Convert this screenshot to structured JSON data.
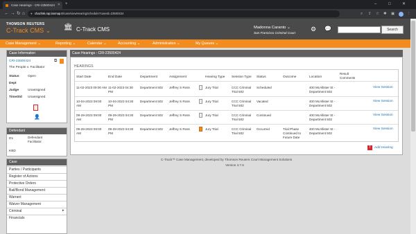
{
  "browser": {
    "tab_title": "Case Hearings - CRI-23500424",
    "url_host": "chazlink.rap.lanmap.tr",
    "url_path": "/case/viewHearingSchedule?caseId=23500424",
    "new_tab": "+",
    "win_minimize": "–",
    "win_maximize": "□",
    "win_close": "✕"
  },
  "header": {
    "company": "THOMSON REUTERS",
    "product": "C-Track CMS ⌄",
    "title": "C-Track CMS",
    "user_name": "Madonna Caranto ⌄",
    "court": "San Francisco Criminal Court",
    "search_placeholder": "",
    "search_button": "Search"
  },
  "nav": {
    "items": [
      "Case Management ⌄",
      "Reporting ⌄",
      "Calendar ⌄",
      "Accounting ⌄",
      "Administration ⌄",
      "My Queues ⌄"
    ]
  },
  "case_info": {
    "header": "Case Information",
    "case_number": "CRI-23500424",
    "case_title": "The People v. Facilitator",
    "status_label": "Status",
    "status_value": "Open",
    "dept_label": "Dept",
    "judge_label": "Judge",
    "judge_value": "Unassigned",
    "timeline_label": "TimeStd",
    "timeline_value": "Unassigned"
  },
  "defendant": {
    "header": "Defendant",
    "num": "D1",
    "name": "Defendant Facilitator",
    "kbd": "KBD"
  },
  "case_menu": {
    "header": "Case",
    "items": [
      "Parties / Participants",
      "Register of Actions",
      "Protective Orders",
      "Bail/Bond Management",
      "Warrant",
      "Waiver Management",
      "Criminal",
      "Financials"
    ]
  },
  "main": {
    "panel_title": "Case Hearings - CRI-23500424",
    "section_label": "HEARINGS",
    "columns": [
      "Start Date",
      "End Date",
      "Department",
      "Assignment",
      "Hearing Type",
      "Session Type",
      "Status",
      "Outcome",
      "Location",
      "Result Comments"
    ],
    "rows": [
      {
        "start": "11-02-2023 09:00 AM",
        "end": "11-02-2023 04:30 PM",
        "dept": "Department 502",
        "assign": "Jeffrey S Ross",
        "hearing_type": "Jury Trial",
        "session_type": "CCC Criminal Trial 502",
        "status": "Scheduled",
        "outcome": "",
        "location": "400 McAllister St - Department 502",
        "action": "View Session"
      },
      {
        "start": "10-04-2023 09:00 AM",
        "end": "10-04-2023 04:30 PM",
        "dept": "Department 502",
        "assign": "Jeffrey S Ross",
        "hearing_type": "Jury Trial",
        "session_type": "CCC Criminal Trial 502",
        "status": "Vacated",
        "outcome": "",
        "location": "400 McAllister St - Department 502",
        "action": "View Session"
      },
      {
        "start": "09-29-2023 09:00 AM",
        "end": "09-29-2023 04:30 PM",
        "dept": "Department 502",
        "assign": "Jeffrey S Ross",
        "hearing_type": "Jury Trial",
        "session_type": "CCC Criminal Trial 502",
        "status": "Continued",
        "outcome": "",
        "location": "400 McAllister St - Department 502",
        "action": "View Session"
      },
      {
        "start": "09-28-2023 09:00 AM",
        "end": "09-28-2023 04:30 PM",
        "dept": "Department 502",
        "assign": "Jeffrey S Ross",
        "hearing_type": "Jury Trial",
        "session_type": "CCC Criminal Trial 502",
        "status": "Occurred",
        "outcome": "Trial Phase Continued to Future Date",
        "location": "400 McAllister St - Department 502",
        "action": "View Session"
      }
    ],
    "add_label": "Add Hearing"
  },
  "footer": {
    "line1": "C-Track™ Case Management, developed by Thomson Reuters Court Management Solutions",
    "line2": "Version 4.7.6"
  }
}
